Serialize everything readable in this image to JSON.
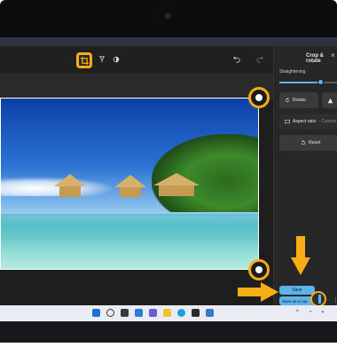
{
  "app": {
    "toolbar": {
      "crop_icon": "crop-icon",
      "flip_icon": "flip-icon",
      "adjust_icon": "adjust-icon",
      "undo_icon": "undo-icon",
      "redo_icon": "redo-icon"
    },
    "panel": {
      "title": "Crop & rotate",
      "close_glyph": "×",
      "straightening_label": "Straightening",
      "straightening_value": 0.7,
      "rotate_label": "Rotate",
      "aspect_ratio_label": "Aspect ratio",
      "aspect_ratio_value": ": Custom",
      "reset_label": "Reset",
      "save_label": "Save",
      "save_as_label": "Save as a cop"
    }
  },
  "colors": {
    "highlight": "#f9ad14",
    "accent": "#5db3ea",
    "panel_bg": "#272727",
    "taskbar_bg": "#e9edf3"
  },
  "taskbar": {
    "icons": [
      "start-icon",
      "search-icon",
      "task-view-icon",
      "widgets-icon",
      "teams-chat-icon",
      "file-explorer-icon",
      "edge-icon",
      "store-icon",
      "photos-icon"
    ]
  }
}
